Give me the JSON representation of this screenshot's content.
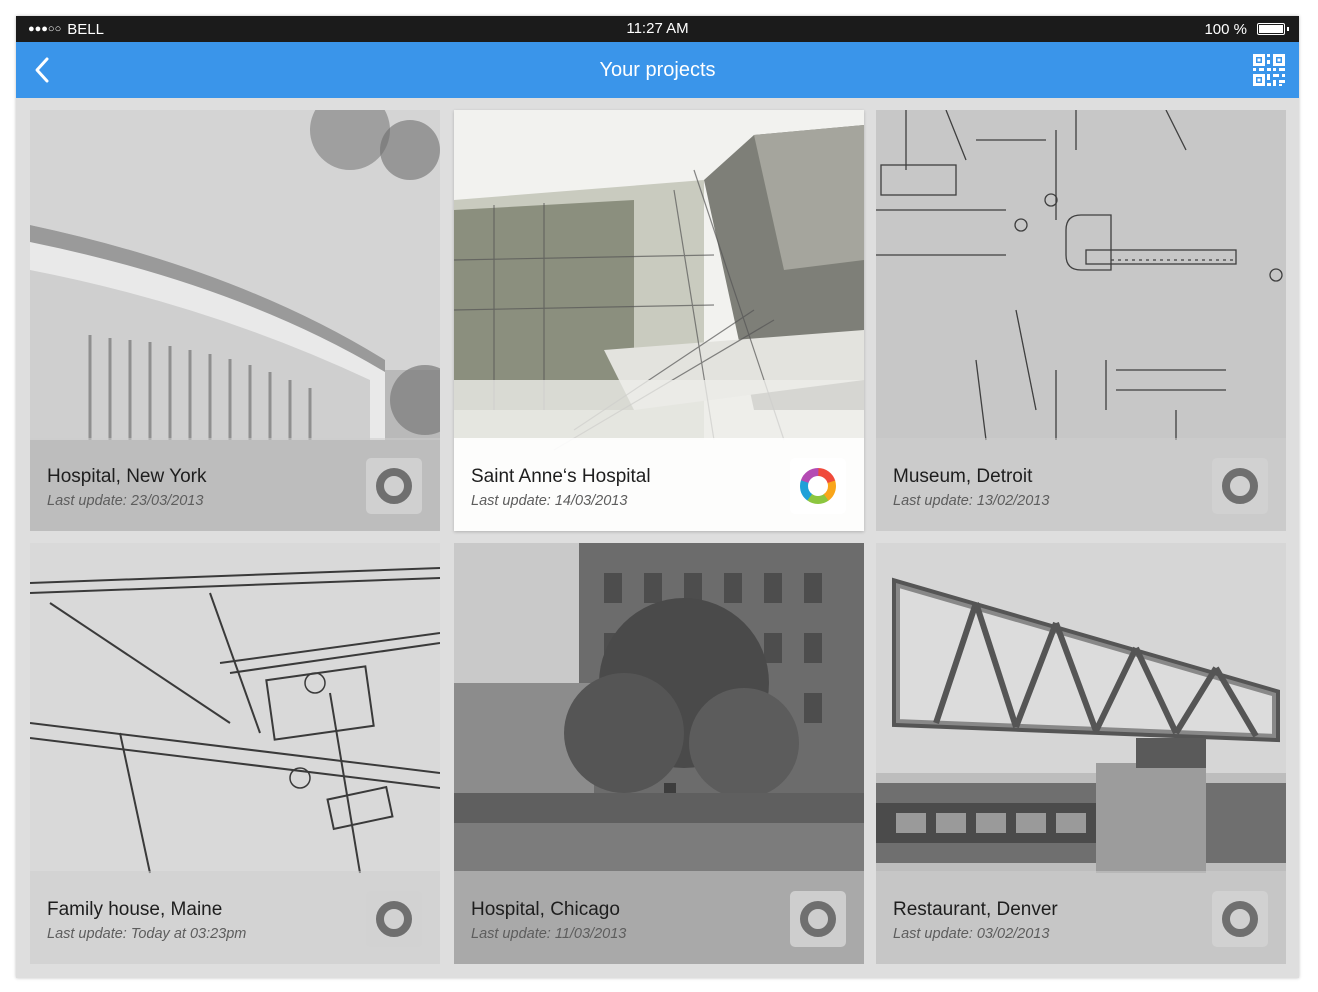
{
  "status": {
    "carrier": "BELL",
    "signal_dots": "●●●○○",
    "time": "11:27 AM",
    "battery": "100 %"
  },
  "appbar": {
    "title": "Your projects",
    "back_icon": "chevron-left-icon",
    "qr_icon": "qr-code-icon"
  },
  "colors": {
    "accent": "#3a95ea",
    "status_bar": "#1b1b1b",
    "progress_ring": [
      "#f04a3a",
      "#f9a51a",
      "#8cc63f",
      "#1fa0d8",
      "#b44bb3"
    ]
  },
  "projects": [
    {
      "name": "Hospital, New York",
      "update": "Last update: 23/03/2013",
      "active": false
    },
    {
      "name": "Saint Anne‘s Hospital",
      "update": "Last update: 14/03/2013",
      "active": true
    },
    {
      "name": "Museum, Detroit",
      "update": "Last update: 13/02/2013",
      "active": false
    },
    {
      "name": "Family house, Maine",
      "update": "Last update: Today at 03:23pm",
      "active": false
    },
    {
      "name": "Hospital, Chicago",
      "update": "Last update: 11/03/2013",
      "active": false
    },
    {
      "name": "Restaurant, Denver",
      "update": "Last update: 03/02/2013",
      "active": false
    }
  ]
}
